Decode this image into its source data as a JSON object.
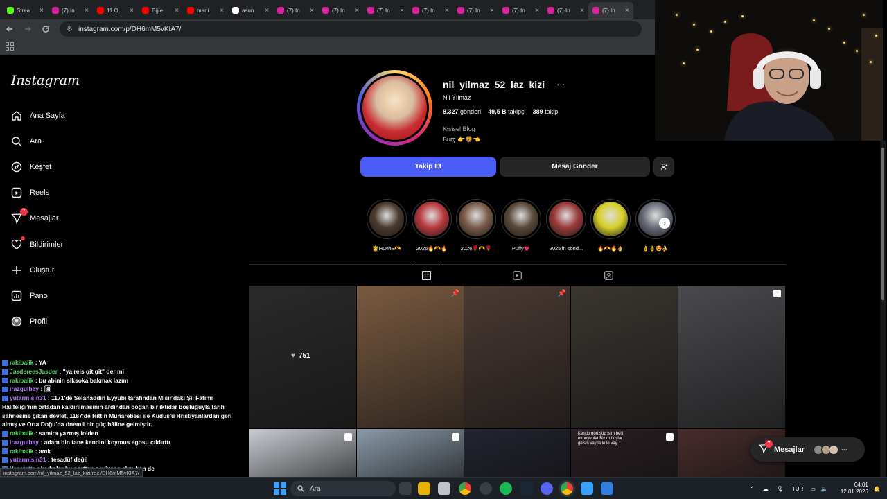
{
  "browser": {
    "tabs": [
      {
        "title": "Strea",
        "color": "#53fc18"
      },
      {
        "title": "(7) In",
        "color": "#d6249f"
      },
      {
        "title": "11 O",
        "color": "#ff0000"
      },
      {
        "title": "Eğle",
        "color": "#ff0000"
      },
      {
        "title": "mani",
        "color": "#ff0000"
      },
      {
        "title": "asun",
        "color": "#ffffff"
      },
      {
        "title": "(7) In",
        "color": "#d6249f"
      },
      {
        "title": "(7) In",
        "color": "#d6249f"
      },
      {
        "title": "(7) In",
        "color": "#d6249f"
      },
      {
        "title": "(7) In",
        "color": "#d6249f"
      },
      {
        "title": "(7) In",
        "color": "#d6249f"
      },
      {
        "title": "(7) In",
        "color": "#d6249f"
      },
      {
        "title": "(7) In",
        "color": "#d6249f"
      },
      {
        "title": "(7) In",
        "color": "#d6249f"
      }
    ],
    "url": "instagram.com/p/DH6mM5vKIA7/",
    "back_icon": "back-arrow-icon",
    "forward_icon": "forward-arrow-icon",
    "reload_icon": "reload-icon"
  },
  "sidebar": {
    "logo": "Instagram",
    "items": [
      {
        "label": "Ana Sayfa",
        "icon": "home-icon"
      },
      {
        "label": "Ara",
        "icon": "search-icon"
      },
      {
        "label": "Keşfet",
        "icon": "explore-icon"
      },
      {
        "label": "Reels",
        "icon": "reels-icon"
      },
      {
        "label": "Mesajlar",
        "icon": "messages-icon",
        "badge": "7"
      },
      {
        "label": "Bildirimler",
        "icon": "heart-icon"
      },
      {
        "label": "Oluştur",
        "icon": "plus-icon"
      },
      {
        "label": "Pano",
        "icon": "dashboard-icon"
      },
      {
        "label": "Profil",
        "icon": "profile-icon"
      }
    ]
  },
  "profile": {
    "username": "nil_yilmaz_52_laz_kizi",
    "full_name": "Nil Yılmaz",
    "posts_count": "8.327",
    "posts_label": "gönderi",
    "followers_count": "49,5 B",
    "followers_label": "takipçi",
    "following_count": "389",
    "following_label": "takip",
    "category": "Kişisel Blog",
    "bio": "Burç 👉🦁👈",
    "follow_button": "Takip Et",
    "message_button": "Mesaj Gönder"
  },
  "highlights": [
    {
      "label": "👸HOME🫶",
      "color": "#4a3a2e"
    },
    {
      "label": "2026🔥🫶🔥",
      "color": "#b83a3e"
    },
    {
      "label": "2026🌹🫶🌹",
      "color": "#7a5a4a"
    },
    {
      "label": "Puffy💗",
      "color": "#5a4a3a"
    },
    {
      "label": "2025'in sond...",
      "color": "#9a3a3a"
    },
    {
      "label": "🔥🫶🔥👌",
      "color": "#d8d02a"
    },
    {
      "label": "👌👌😍🍌",
      "color": "#6a6e7a"
    }
  ],
  "posts": [
    {
      "type": "video",
      "likes": "751",
      "bg": "#2a2a2a"
    },
    {
      "type": "pinned",
      "bg": "#7a5a40"
    },
    {
      "type": "pinned",
      "bg": "#4a3a34"
    },
    {
      "type": "image",
      "bg": "#3a3530"
    },
    {
      "type": "reel",
      "bg": "#4a4a4e"
    },
    {
      "type": "reel",
      "bg": "#c8ccd2"
    },
    {
      "type": "reel",
      "bg": "#8a9aa8"
    },
    {
      "type": "image",
      "bg": "#222430"
    },
    {
      "type": "reel",
      "bg": "#2a1e24",
      "overlay_text": "Kendo görüşüp isim belli etmeyenler Bizim hoşlar gelsin vay la le le vay"
    },
    {
      "type": "image",
      "bg": "#4a2c2c"
    }
  ],
  "chat": [
    {
      "user": "rakibalik",
      "user_color": "u",
      "text": "YA"
    },
    {
      "user": "JasdereesJasder",
      "user_color": "u",
      "text": "\"ya reis git git\" der mi"
    },
    {
      "user": "rakibalik",
      "user_color": "u",
      "text": "bu abinin siksoka bakmak lazım"
    },
    {
      "user": "irazgulbay",
      "user_color": "u2",
      "text": "🖼"
    },
    {
      "user": "yutarmisin31",
      "user_color": "u2",
      "text": "1171'de Selahaddin Eyyubi tarafından Mısır'daki Şii Fâtımî Hâlifeliği'nin ortadan kaldırılmasının ardından doğan bir iktidar boşluğuyla tarih sahnesine çıkan devlet, 1187'de Hittin Muharebesi ile Kudüs'ü Hristiyanlardan geri almış ve Orta Doğu'da önemli bir güç hâline gelmiştir."
    },
    {
      "user": "rakibalik",
      "user_color": "u",
      "text": "samira yazmış loiden"
    },
    {
      "user": "irazgulbay",
      "user_color": "u2",
      "text": "adam bin tane kendini koymus egosu çıldırttı"
    },
    {
      "user": "rakibalik",
      "user_color": "u",
      "text": "amk"
    },
    {
      "user": "yutarmisin31",
      "user_color": "u2",
      "text": "tesadüf değil"
    },
    {
      "user": "Vasatatta",
      "user_color": "u3",
      "text": "kadınlar bu şorttan seviyosa alım ben de"
    }
  ],
  "status_url": "instagram.com/nil_yilmaz_52_laz_kizi/reel/DH6mM5vKIA7/",
  "messages_float": {
    "label": "Mesajlar",
    "badge": "7"
  },
  "taskbar": {
    "search_placeholder": "Ara",
    "language": "TUR",
    "time": "04:01",
    "date": "12.01.2026"
  }
}
